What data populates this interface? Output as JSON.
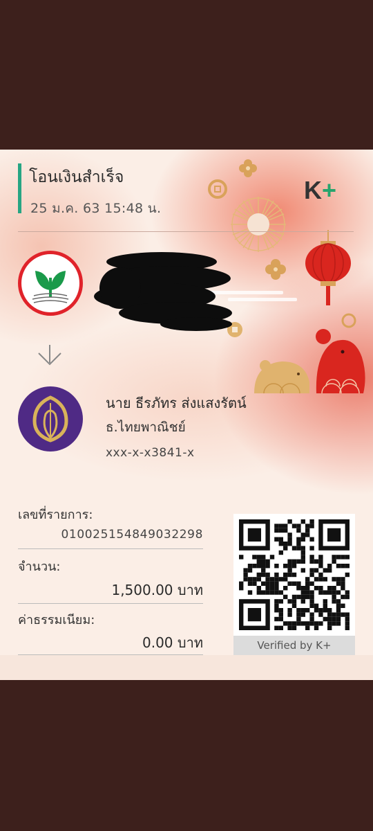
{
  "slip": {
    "title": "โอนเงินสำเร็จ",
    "datetime": "25 ม.ค. 63  15:48 น.",
    "brand_k": "K",
    "brand_plus": "+"
  },
  "receiver": {
    "name": "นาย ธีรภัทร ส่งแสงรัตน์",
    "bank": "ธ.ไทยพาณิชย์",
    "account": "xxx-x-x3841-x"
  },
  "details": {
    "txn_label": "เลขที่รายการ:",
    "txn_value": "010025154849032298",
    "amount_label": "จำนวน:",
    "amount_value": "1,500.00 บาท",
    "fee_label": "ค่าธรรมเนียม:",
    "fee_value": "0.00 บาท"
  },
  "qr": {
    "verified_label": "Verified by K+"
  },
  "icons": {
    "sender_bank": "kasikorn-leaf-icon",
    "receiver_bank": "scb-bodhi-leaf-icon",
    "arrow": "arrow-down-icon"
  },
  "colors": {
    "accent_green": "#27a583",
    "scb_purple": "#4f2a85",
    "kbank_red": "#e0232a"
  }
}
